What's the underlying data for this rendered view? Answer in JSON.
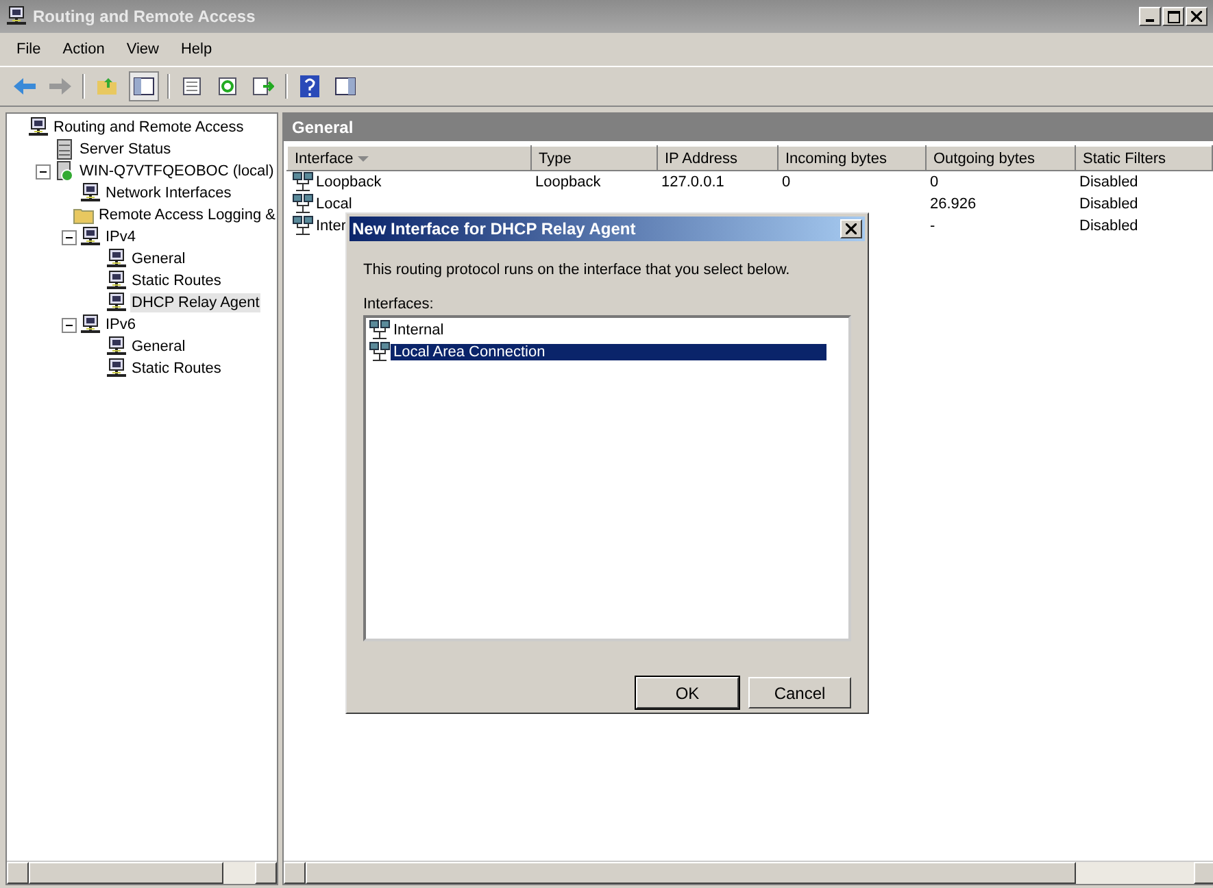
{
  "window": {
    "title": "Routing and Remote Access"
  },
  "menu": [
    "File",
    "Action",
    "View",
    "Help"
  ],
  "tree": [
    {
      "label": "Routing and Remote Access",
      "kind": "root",
      "selected": false,
      "children": [
        {
          "label": "Server Status",
          "kind": "status",
          "selected": false
        },
        {
          "label": "WIN-Q7VTFQEOBOC (local)",
          "kind": "server",
          "expanded": true,
          "selected": false,
          "children": [
            {
              "label": "Network Interfaces",
              "kind": "node",
              "selected": false
            },
            {
              "label": "Remote Access Logging &",
              "kind": "folder",
              "selected": false
            },
            {
              "label": "IPv4",
              "kind": "node",
              "expanded": true,
              "selected": false,
              "children": [
                {
                  "label": "General",
                  "kind": "node",
                  "selected": false
                },
                {
                  "label": "Static Routes",
                  "kind": "node",
                  "selected": false
                },
                {
                  "label": "DHCP Relay Agent",
                  "kind": "node",
                  "selected": true
                }
              ]
            },
            {
              "label": "IPv6",
              "kind": "node",
              "expanded": true,
              "selected": false,
              "children": [
                {
                  "label": "General",
                  "kind": "node",
                  "selected": false
                },
                {
                  "label": "Static Routes",
                  "kind": "node",
                  "selected": false
                }
              ]
            }
          ]
        }
      ]
    }
  ],
  "panel": {
    "title": "General",
    "columns": [
      "Interface",
      "Type",
      "IP Address",
      "Incoming bytes",
      "Outgoing bytes",
      "Static Filters"
    ],
    "rows": [
      {
        "interface": "Loopback",
        "type": "Loopback",
        "ip_address": "127.0.0.1",
        "incoming_bytes": "0",
        "outgoing_bytes": "0",
        "static_filters": "Disabled"
      },
      {
        "interface": "Local",
        "outgoing_bytes": "26.926",
        "static_filters": "Disabled"
      },
      {
        "interface": "Inter",
        "outgoing_bytes": "-",
        "static_filters": "Disabled"
      }
    ]
  },
  "dialog": {
    "title": "New Interface for DHCP Relay Agent",
    "message": "This routing protocol runs on the interface that you select below.",
    "list_label": "Interfaces:",
    "items": [
      {
        "label": "Internal",
        "selected": false
      },
      {
        "label": "Local Area Connection",
        "selected": true
      }
    ],
    "buttons": [
      {
        "label": "OK",
        "default": true
      },
      {
        "label": "Cancel",
        "default": false
      }
    ]
  }
}
